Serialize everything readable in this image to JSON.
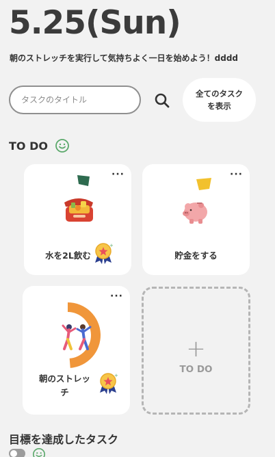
{
  "header": {
    "date": "5.25(Sun)",
    "subtitle": "朝のストレッチを実行して気持ちよく一日を始めよう！dddd"
  },
  "search": {
    "placeholder": "タスクのタイトル",
    "value": ""
  },
  "all_tasks_button": {
    "line1": "全てのタスク",
    "line2": "を表示"
  },
  "todo_section": {
    "title": "TO DO",
    "cards": [
      {
        "label": "水を2L飲む",
        "icon": "lunchbox-illustration",
        "tag_color": "#2e6b4f",
        "has_badge": true
      },
      {
        "label": "貯金をする",
        "icon": "piggy-bank-illustration",
        "tag_color": "#f2c12e",
        "has_badge": false
      },
      {
        "label_line1": "朝のストレッ",
        "label_line2": "チ",
        "icon": "stretching-people-illustration",
        "progress_color": "#f0963a",
        "has_badge": true
      }
    ],
    "add_card": {
      "plus": "+",
      "label": "TO DO"
    },
    "more_label": "···"
  },
  "done_section": {
    "title": "目標を達成したタスク"
  },
  "colors": {
    "background": "#f2f2f2",
    "card": "#ffffff",
    "smile_green": "#5aa86a",
    "progress_orange": "#f0963a"
  }
}
